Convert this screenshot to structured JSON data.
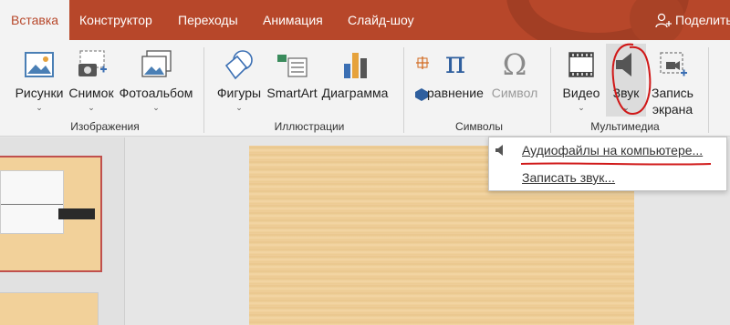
{
  "tabs": [
    {
      "label": "Вставка",
      "active": true
    },
    {
      "label": "Конструктор"
    },
    {
      "label": "Переходы"
    },
    {
      "label": "Анимация"
    },
    {
      "label": "Слайд-шоу"
    }
  ],
  "share_label": "Поделить",
  "ribbon": {
    "images": {
      "group_label": "Изображения",
      "pictures": "Рисунки",
      "screenshot": "Снимок",
      "album": "Фотоальбом"
    },
    "illustrations": {
      "group_label": "Иллюстрации",
      "shapes": "Фигуры",
      "smartart": "SmartArt",
      "chart": "Диаграмма"
    },
    "symbols": {
      "group_label": "Символы",
      "equation": "равнение",
      "symbol": "Символ"
    },
    "media": {
      "group_label": "Мультимедиа",
      "video": "Видео",
      "audio": "Звук",
      "record_line1": "Запись",
      "record_line2": "экрана"
    }
  },
  "audio_menu": {
    "item1": "Аудиофайлы на компьютере...",
    "item2": "Записать звук..."
  },
  "colors": {
    "accent": "#b7472a",
    "annotation": "#d01818"
  }
}
